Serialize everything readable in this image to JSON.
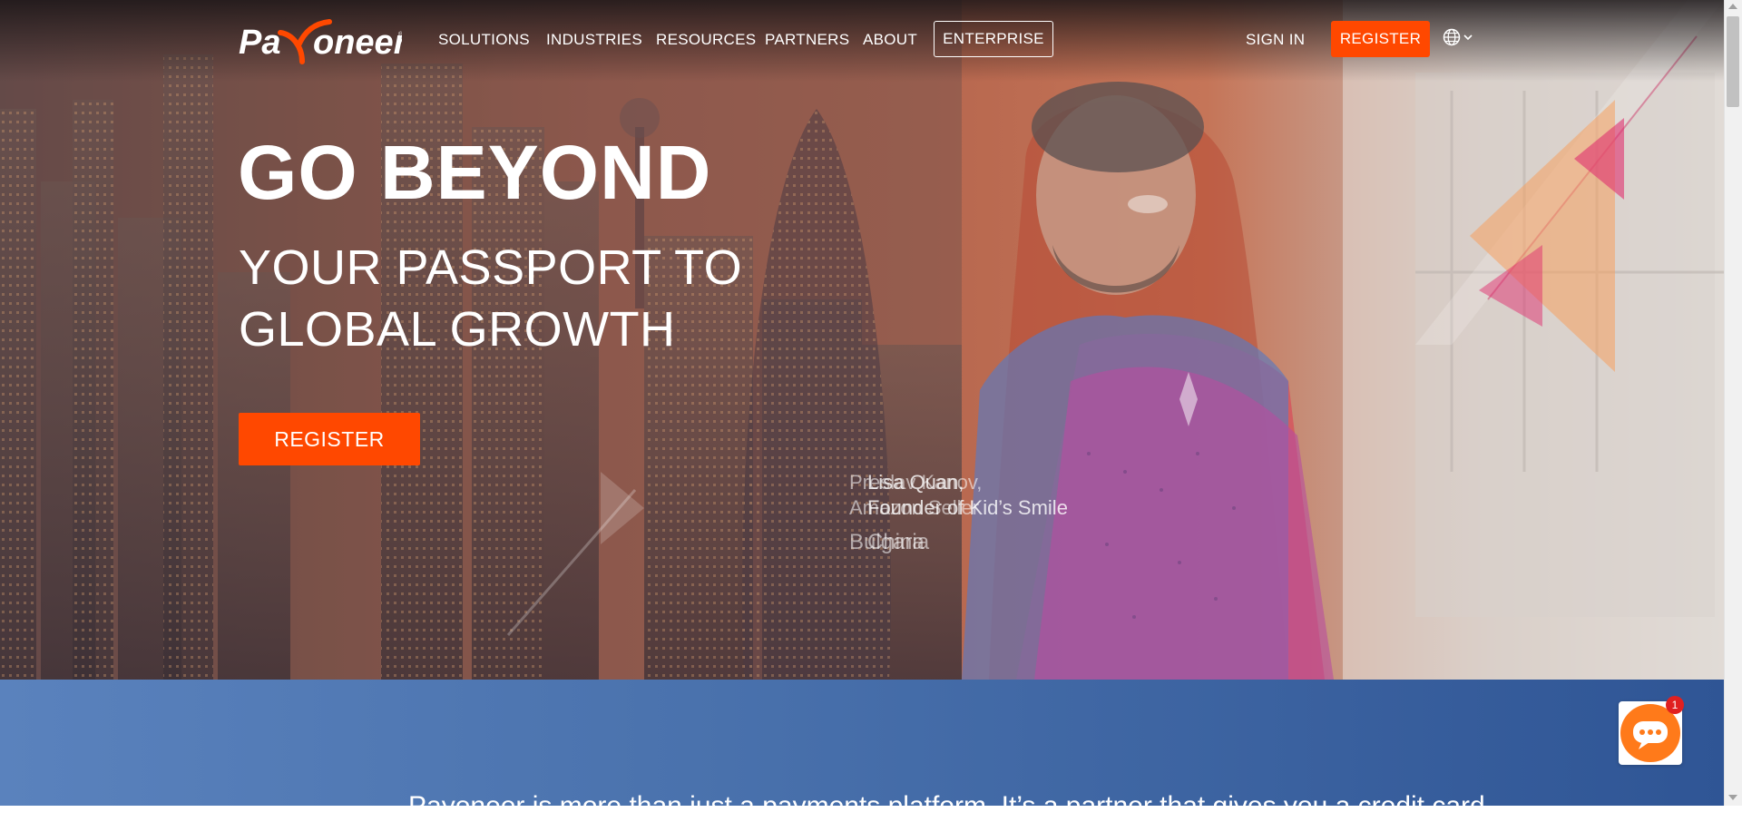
{
  "brand": {
    "logo_text": "Payoneer",
    "accent": "#ff4800",
    "chat_color": "#ff7a1a",
    "band_color": "#4a72ad"
  },
  "nav": {
    "items": [
      {
        "label": "SOLUTIONS"
      },
      {
        "label": "INDUSTRIES"
      },
      {
        "label": "RESOURCES"
      },
      {
        "label": "PARTNERS"
      },
      {
        "label": "ABOUT"
      }
    ],
    "enterprise": "ENTERPRISE",
    "sign_in": "SIGN IN",
    "register": "REGISTER",
    "language_icon": "globe-icon"
  },
  "hero": {
    "headline": "GO BEYOND",
    "subheadline_line1": "YOUR PASSPORT TO",
    "subheadline_line2": "GLOBAL GROWTH",
    "cta": "REGISTER",
    "testimonial_a": {
      "name": "Preslav Kanov,",
      "role": "Amazon Seller",
      "country": "Bulgaria"
    },
    "testimonial_b": {
      "name": "Lisa Quan,",
      "role": "Founder of Kid’s Smile",
      "country": "China"
    }
  },
  "band": {
    "text": "Payoneer is more than just a payments platform. It’s a partner that gives you a credit card..."
  },
  "chat": {
    "badge_count": "1",
    "icon": "chat-icon"
  }
}
